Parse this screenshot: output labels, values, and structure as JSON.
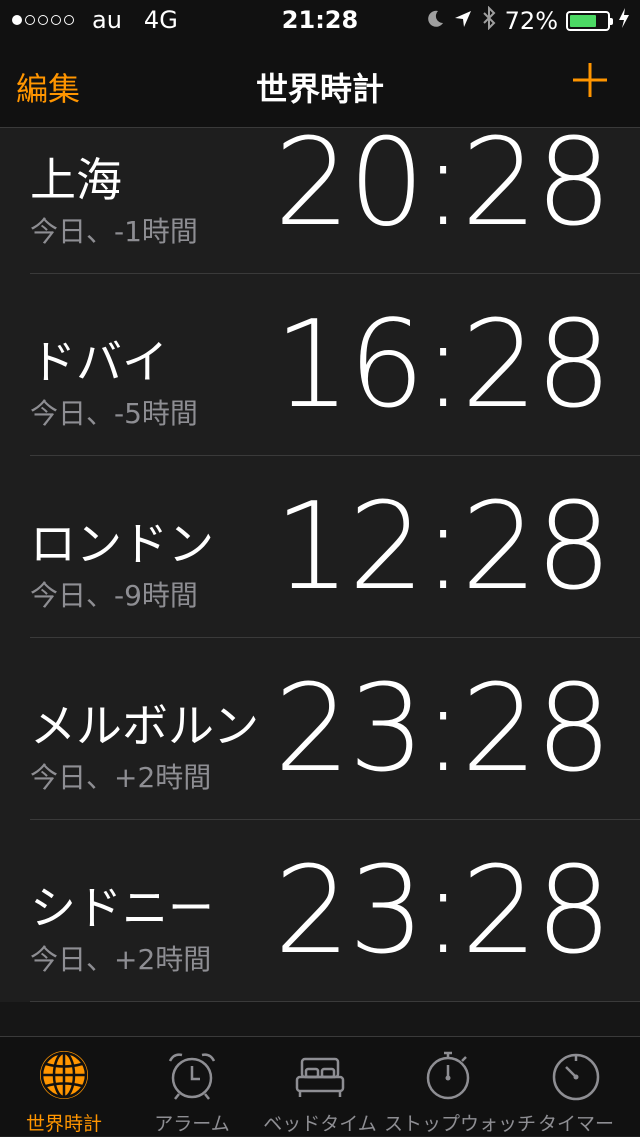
{
  "status_bar": {
    "signal_dots_filled": 1,
    "signal_dots_total": 5,
    "carrier": "au",
    "network": "4G",
    "time": "21:28",
    "battery": "72%",
    "battery_level": 0.72,
    "battery_color": "#4cd964",
    "icons": [
      "moon-icon",
      "location-arrow-icon",
      "bluetooth-icon",
      "battery-icon",
      "charging-bolt-icon"
    ]
  },
  "nav": {
    "edit_label": "編集",
    "title": "世界時計",
    "add_icon": "plus-icon",
    "accent_color": "#ff9500"
  },
  "clocks": [
    {
      "city": "上海",
      "offset": "今日、-1時間",
      "time": "20:28"
    },
    {
      "city": "ドバイ",
      "offset": "今日、-5時間",
      "time": "16:28"
    },
    {
      "city": "ロンドン",
      "offset": "今日、-9時間",
      "time": "12:28"
    },
    {
      "city": "メルボルン",
      "offset": "今日、+2時間",
      "time": "23:28"
    },
    {
      "city": "シドニー",
      "offset": "今日、+2時間",
      "time": "23:28"
    }
  ],
  "tabs": [
    {
      "label": "世界時計",
      "icon": "globe-icon",
      "active": true
    },
    {
      "label": "アラーム",
      "icon": "alarm-clock-icon",
      "active": false
    },
    {
      "label": "ベッドタイム",
      "icon": "bed-icon",
      "active": false
    },
    {
      "label": "ストップウォッチ",
      "icon": "stopwatch-icon",
      "active": false
    },
    {
      "label": "タイマー",
      "icon": "timer-icon",
      "active": false
    }
  ]
}
